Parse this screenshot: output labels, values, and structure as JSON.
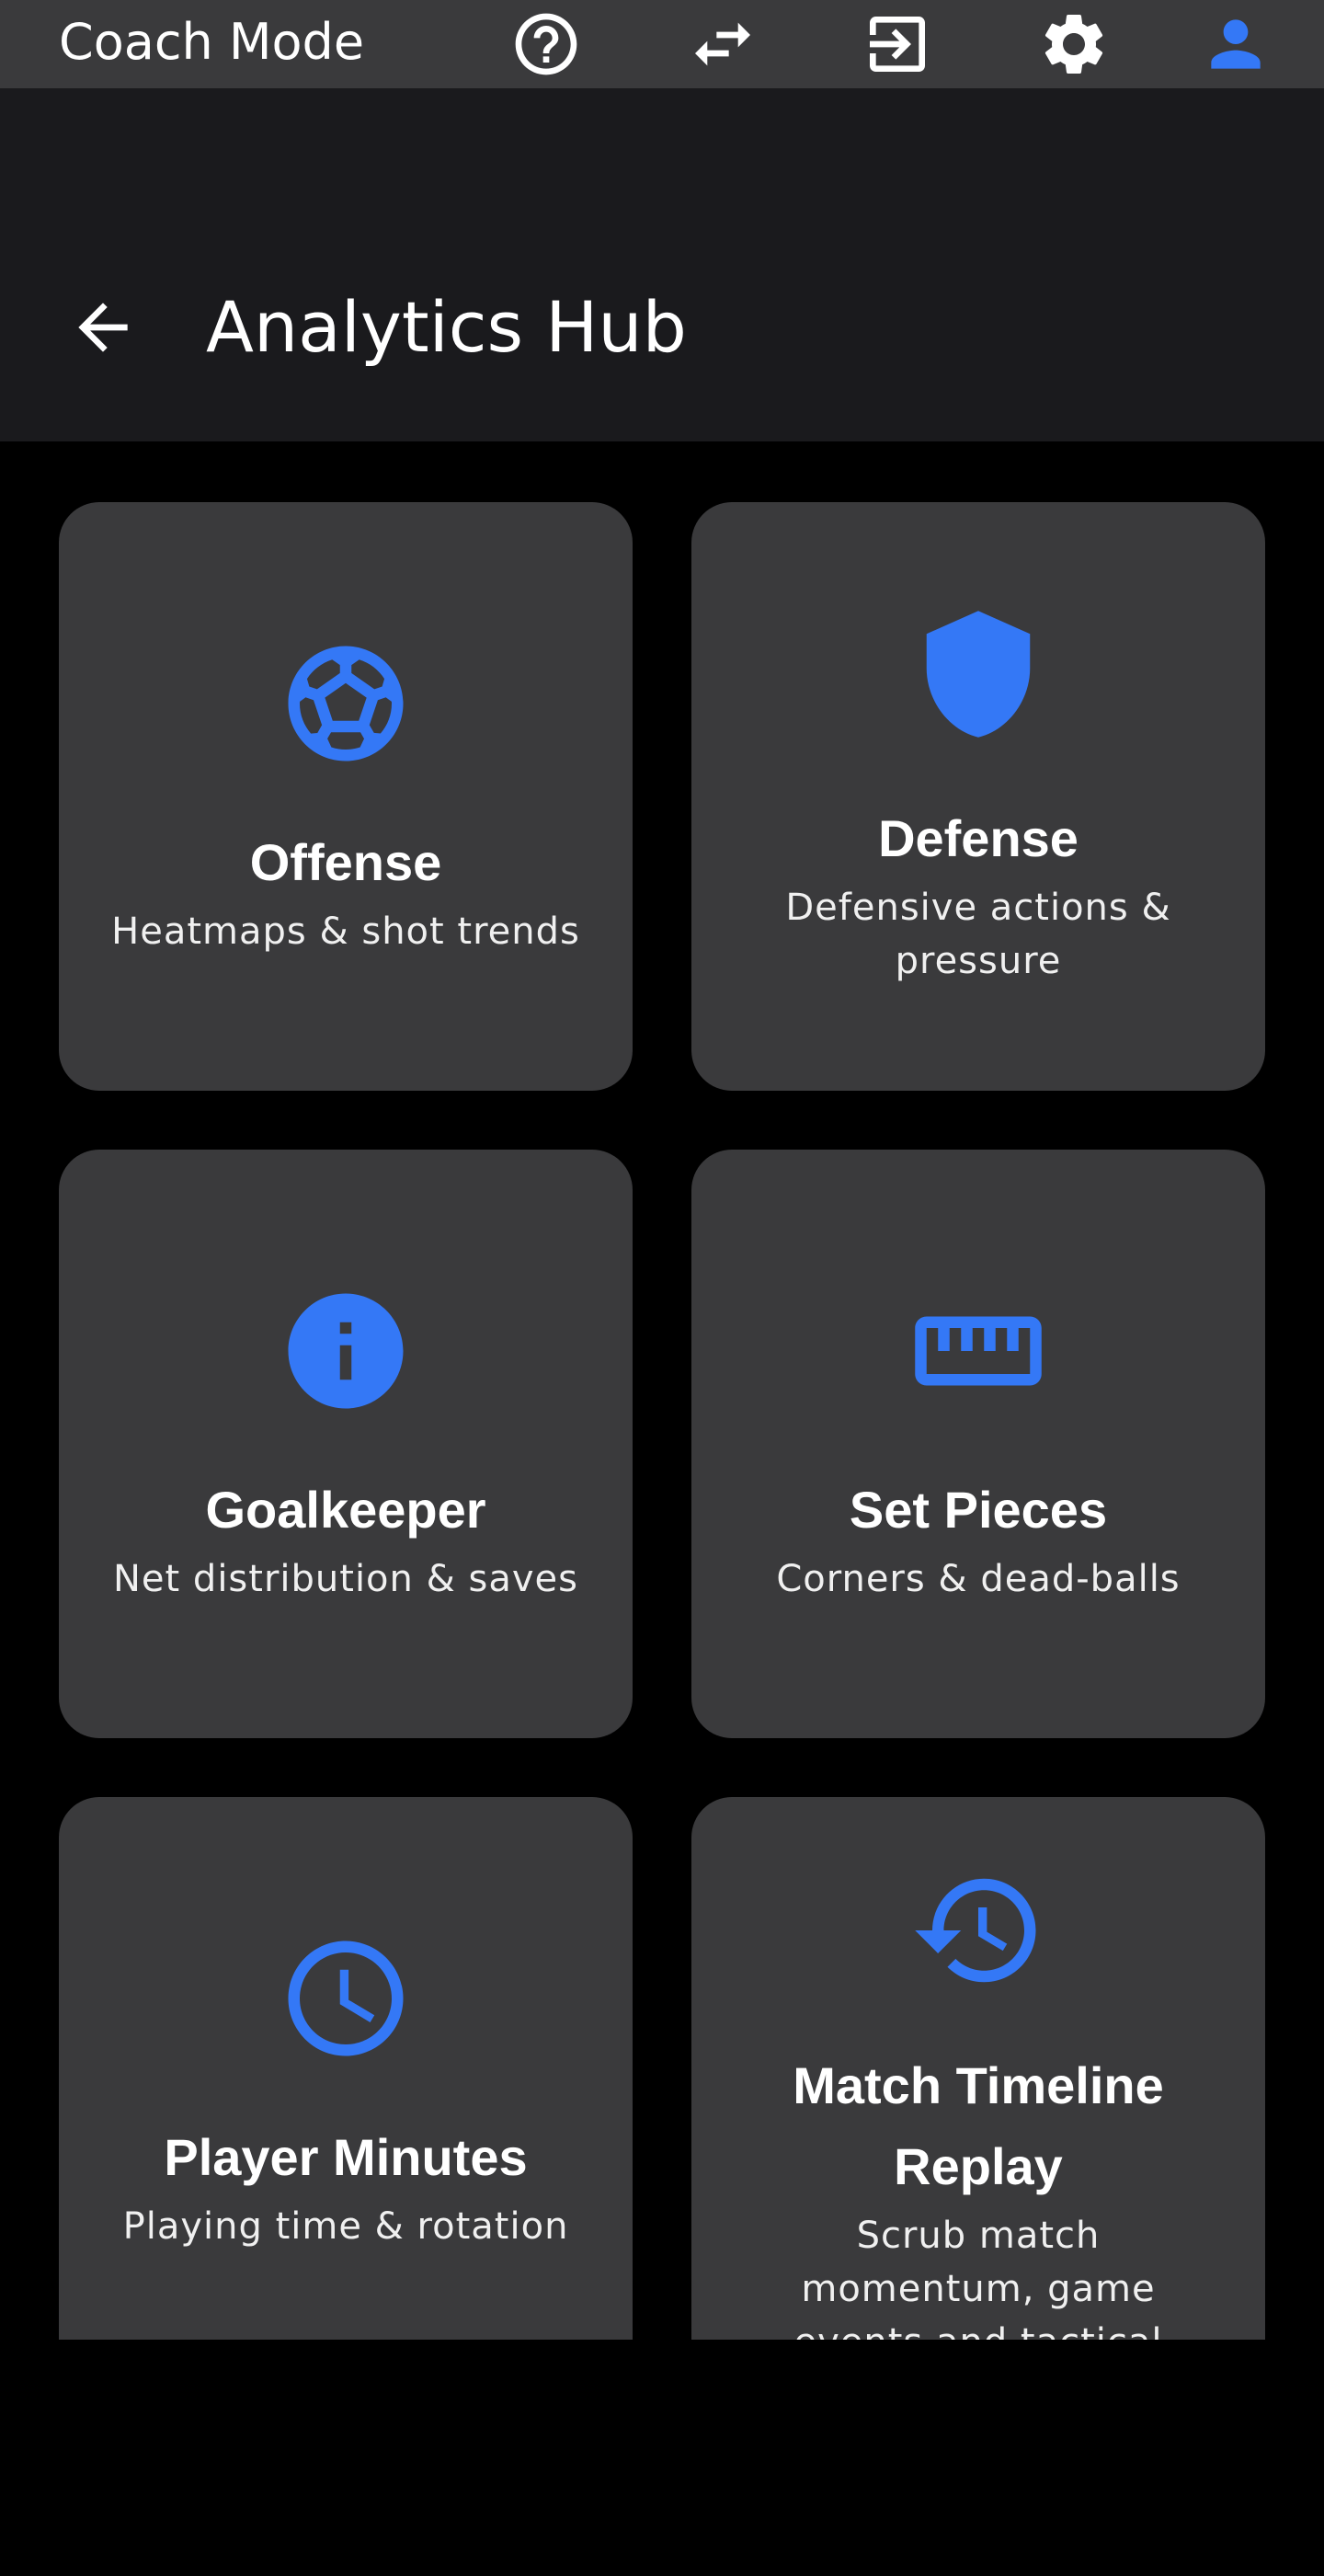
{
  "topbar": {
    "title": "Coach Mode",
    "icons": [
      "help-circle-icon",
      "swap-arrows-icon",
      "login-icon",
      "gear-icon",
      "account-icon"
    ]
  },
  "appbar": {
    "title": "Analytics Hub",
    "back_icon": "arrow-back-icon"
  },
  "colors": {
    "accent": "#3478f6",
    "card_bg": "#3a3a3c",
    "topbar_bg": "#3a3a3c",
    "appbar_bg": "#1a1a1d",
    "page_bg": "#000000"
  },
  "cards": [
    {
      "title": "Offense",
      "subtitle": "Heatmaps & shot trends",
      "icon": "soccer-ball-icon"
    },
    {
      "title": "Defense",
      "subtitle": "Defensive actions & pressure",
      "icon": "shield-icon"
    },
    {
      "title": "Goalkeeper",
      "subtitle": "Net distribution & saves",
      "icon": "info-icon"
    },
    {
      "title": "Set Pieces",
      "subtitle": "Corners & dead-balls",
      "icon": "ruler-icon"
    },
    {
      "title": "Player Minutes",
      "subtitle": "Playing time & rotation",
      "icon": "clock-icon"
    },
    {
      "title": "Match Timeline Replay",
      "subtitle": "Scrub match momentum, game events and tactical changes",
      "icon": "history-icon"
    }
  ]
}
